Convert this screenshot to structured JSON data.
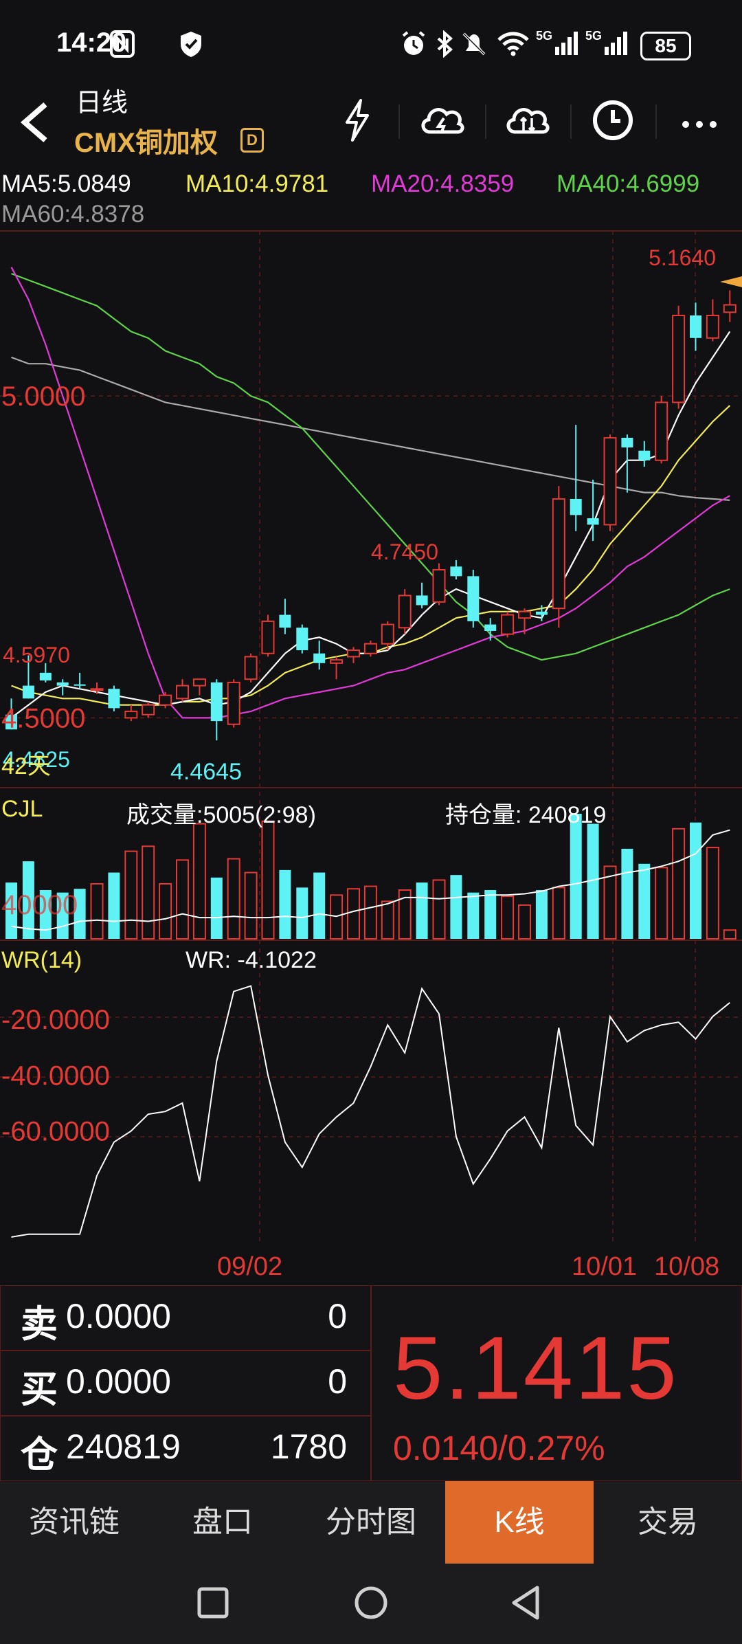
{
  "status": {
    "time": "14:20",
    "battery": "85"
  },
  "header": {
    "period": "日线",
    "symbol": "CMX铜加权",
    "badge": "D"
  },
  "ma": {
    "ma5": "MA5:5.0849",
    "ma10": "MA10:4.9781",
    "ma20": "MA20:4.8359",
    "ma40": "MA40:4.6999",
    "ma60": "MA60:4.8378"
  },
  "price_chart": {
    "axis_label_top": "5.0000",
    "axis_label_mid": "4.5000",
    "high_label": "5.1640",
    "peak_label": "4.7450",
    "left_label": "4.5970",
    "low_label": "4.4645",
    "left_low_label": "4.4825",
    "days_label": "42天"
  },
  "volume_panel": {
    "title": "CJL",
    "volume_text": "成交量:5005(2:98)",
    "oi_text": "持仓量: 240819",
    "axis_label": "40000"
  },
  "wr_panel": {
    "title": "WR(14)",
    "value_text": "WR: -4.1022",
    "ticks": [
      "-20.0000",
      "-40.0000",
      "-60.0000"
    ]
  },
  "dates": [
    "09/02",
    "10/01",
    "10/08"
  ],
  "order_book": {
    "sell_label": "卖",
    "sell_price": "0.0000",
    "sell_qty": "0",
    "buy_label": "买",
    "buy_price": "0.0000",
    "buy_qty": "0",
    "oi_label": "仓",
    "oi_value": "240819",
    "oi_change": "1780",
    "last_price": "5.1415",
    "change": "0.0140/0.27%"
  },
  "tabs": [
    "资讯链",
    "盘口",
    "分时图",
    "K线",
    "交易"
  ],
  "colors": {
    "up": "#e53935",
    "down": "#5ff2f5",
    "ma5": "#ffffff",
    "ma10": "#f2ec58",
    "ma20": "#e23ad8",
    "ma40": "#5fd44a",
    "ma60": "#aaaaaa",
    "accent": "#e06a2a"
  },
  "chart_data": {
    "type": "candlestick",
    "y_range": [
      4.43,
      5.22
    ],
    "candles": [
      {
        "o": 4.505,
        "h": 4.53,
        "l": 4.482,
        "c": 4.482
      },
      {
        "o": 4.55,
        "h": 4.597,
        "l": 4.53,
        "c": 4.53
      },
      {
        "o": 4.57,
        "h": 4.585,
        "l": 4.555,
        "c": 4.558
      },
      {
        "o": 4.555,
        "h": 4.56,
        "l": 4.535,
        "c": 4.55
      },
      {
        "o": 4.552,
        "h": 4.57,
        "l": 4.545,
        "c": 4.55
      },
      {
        "o": 4.545,
        "h": 4.555,
        "l": 4.537,
        "c": 4.545
      },
      {
        "o": 4.545,
        "h": 4.55,
        "l": 4.51,
        "c": 4.515
      },
      {
        "o": 4.5,
        "h": 4.52,
        "l": 4.495,
        "c": 4.51
      },
      {
        "o": 4.505,
        "h": 4.525,
        "l": 4.5,
        "c": 4.52
      },
      {
        "o": 4.52,
        "h": 4.54,
        "l": 4.515,
        "c": 4.535
      },
      {
        "o": 4.53,
        "h": 4.56,
        "l": 4.525,
        "c": 4.55
      },
      {
        "o": 4.55,
        "h": 4.56,
        "l": 4.535,
        "c": 4.56
      },
      {
        "o": 4.555,
        "h": 4.56,
        "l": 4.465,
        "c": 4.495
      },
      {
        "o": 4.49,
        "h": 4.56,
        "l": 4.485,
        "c": 4.555
      },
      {
        "o": 4.56,
        "h": 4.6,
        "l": 4.555,
        "c": 4.595
      },
      {
        "o": 4.6,
        "h": 4.66,
        "l": 4.595,
        "c": 4.65
      },
      {
        "o": 4.66,
        "h": 4.685,
        "l": 4.63,
        "c": 4.64
      },
      {
        "o": 4.64,
        "h": 4.645,
        "l": 4.6,
        "c": 4.605
      },
      {
        "o": 4.6,
        "h": 4.62,
        "l": 4.575,
        "c": 4.585
      },
      {
        "o": 4.585,
        "h": 4.595,
        "l": 4.56,
        "c": 4.59
      },
      {
        "o": 4.595,
        "h": 4.61,
        "l": 4.585,
        "c": 4.605
      },
      {
        "o": 4.6,
        "h": 4.62,
        "l": 4.595,
        "c": 4.615
      },
      {
        "o": 4.615,
        "h": 4.65,
        "l": 4.605,
        "c": 4.645
      },
      {
        "o": 4.64,
        "h": 4.7,
        "l": 4.63,
        "c": 4.69
      },
      {
        "o": 4.69,
        "h": 4.71,
        "l": 4.67,
        "c": 4.675
      },
      {
        "o": 4.68,
        "h": 4.74,
        "l": 4.675,
        "c": 4.73
      },
      {
        "o": 4.735,
        "h": 4.745,
        "l": 4.715,
        "c": 4.72
      },
      {
        "o": 4.72,
        "h": 4.73,
        "l": 4.64,
        "c": 4.65
      },
      {
        "o": 4.645,
        "h": 4.655,
        "l": 4.62,
        "c": 4.635
      },
      {
        "o": 4.63,
        "h": 4.665,
        "l": 4.625,
        "c": 4.66
      },
      {
        "o": 4.655,
        "h": 4.67,
        "l": 4.63,
        "c": 4.665
      },
      {
        "o": 4.665,
        "h": 4.675,
        "l": 4.65,
        "c": 4.66
      },
      {
        "o": 4.67,
        "h": 4.86,
        "l": 4.64,
        "c": 4.84
      },
      {
        "o": 4.84,
        "h": 4.955,
        "l": 4.79,
        "c": 4.815
      },
      {
        "o": 4.81,
        "h": 4.87,
        "l": 4.775,
        "c": 4.8
      },
      {
        "o": 4.8,
        "h": 4.94,
        "l": 4.79,
        "c": 4.935
      },
      {
        "o": 4.935,
        "h": 4.94,
        "l": 4.85,
        "c": 4.92
      },
      {
        "o": 4.915,
        "h": 4.93,
        "l": 4.89,
        "c": 4.9
      },
      {
        "o": 4.9,
        "h": 5.0,
        "l": 4.895,
        "c": 4.99
      },
      {
        "o": 4.99,
        "h": 5.14,
        "l": 4.98,
        "c": 5.125
      },
      {
        "o": 5.125,
        "h": 5.145,
        "l": 5.07,
        "c": 5.09
      },
      {
        "o": 5.09,
        "h": 5.15,
        "l": 5.085,
        "c": 5.125
      },
      {
        "o": 5.13,
        "h": 5.164,
        "l": 5.115,
        "c": 5.1415
      }
    ],
    "ma5": [
      4.5,
      4.52,
      4.54,
      4.55,
      4.545,
      4.54,
      4.535,
      4.53,
      4.525,
      4.52,
      4.525,
      4.53,
      4.52,
      4.525,
      4.54,
      4.57,
      4.6,
      4.62,
      4.625,
      4.615,
      4.6,
      4.6,
      4.605,
      4.63,
      4.66,
      4.685,
      4.7,
      4.69,
      4.68,
      4.67,
      4.66,
      4.655,
      4.7,
      4.75,
      4.8,
      4.87,
      4.9,
      4.9,
      4.91,
      4.97,
      5.02,
      5.06,
      5.1
    ],
    "ma10": [
      4.55,
      4.54,
      4.535,
      4.53,
      4.53,
      4.525,
      4.52,
      4.52,
      4.52,
      4.52,
      4.525,
      4.525,
      4.53,
      4.53,
      4.535,
      4.55,
      4.57,
      4.58,
      4.59,
      4.595,
      4.6,
      4.6,
      4.61,
      4.615,
      4.625,
      4.64,
      4.655,
      4.66,
      4.665,
      4.665,
      4.665,
      4.67,
      4.675,
      4.7,
      4.73,
      4.77,
      4.8,
      4.83,
      4.86,
      4.9,
      4.93,
      4.96,
      4.985
    ],
    "ma20": [
      5.2,
      5.15,
      5.08,
      5.0,
      4.92,
      4.84,
      4.76,
      4.68,
      4.6,
      4.53,
      4.5,
      4.5,
      4.5,
      4.505,
      4.51,
      4.52,
      4.53,
      4.535,
      4.54,
      4.545,
      4.55,
      4.56,
      4.57,
      4.575,
      4.585,
      4.595,
      4.605,
      4.615,
      4.625,
      4.63,
      4.635,
      4.645,
      4.655,
      4.67,
      4.69,
      4.71,
      4.735,
      4.75,
      4.77,
      4.79,
      4.81,
      4.83,
      4.845
    ],
    "ma40": [
      5.19,
      5.18,
      5.17,
      5.16,
      5.15,
      5.14,
      5.12,
      5.1,
      5.09,
      5.07,
      5.06,
      5.05,
      5.03,
      5.02,
      5.0,
      4.99,
      4.97,
      4.95,
      4.92,
      4.89,
      4.86,
      4.83,
      4.8,
      4.77,
      4.74,
      4.71,
      4.68,
      4.66,
      4.63,
      4.61,
      4.6,
      4.59,
      4.595,
      4.6,
      4.61,
      4.62,
      4.63,
      4.64,
      4.65,
      4.66,
      4.675,
      4.69,
      4.7
    ],
    "ma60": [
      5.06,
      5.05,
      5.05,
      5.045,
      5.04,
      5.03,
      5.02,
      5.01,
      5.0,
      4.99,
      4.985,
      4.98,
      4.975,
      4.97,
      4.965,
      4.96,
      4.955,
      4.95,
      4.945,
      4.94,
      4.935,
      4.93,
      4.925,
      4.92,
      4.915,
      4.91,
      4.905,
      4.9,
      4.895,
      4.89,
      4.885,
      4.88,
      4.875,
      4.87,
      4.865,
      4.86,
      4.855,
      4.85,
      4.85,
      4.845,
      4.842,
      4.84,
      4.838
    ],
    "volume": [
      0.45,
      0.62,
      0.39,
      0.37,
      0.4,
      0.44,
      0.53,
      0.7,
      0.74,
      0.44,
      0.63,
      0.92,
      0.49,
      0.64,
      0.53,
      0.94,
      0.55,
      0.41,
      0.53,
      0.35,
      0.4,
      0.42,
      0.3,
      0.39,
      0.45,
      0.47,
      0.51,
      0.37,
      0.39,
      0.34,
      0.27,
      0.39,
      0.41,
      1.0,
      0.92,
      0.58,
      0.72,
      0.6,
      0.57,
      0.88,
      0.93,
      0.73,
      0.07
    ],
    "oi_line": [
      0.1,
      0.08,
      0.07,
      0.1,
      0.14,
      0.15,
      0.14,
      0.15,
      0.14,
      0.16,
      0.2,
      0.17,
      0.17,
      0.18,
      0.17,
      0.17,
      0.18,
      0.17,
      0.2,
      0.18,
      0.22,
      0.25,
      0.28,
      0.33,
      0.33,
      0.32,
      0.33,
      0.34,
      0.35,
      0.35,
      0.36,
      0.38,
      0.42,
      0.44,
      0.47,
      0.5,
      0.53,
      0.55,
      0.58,
      0.62,
      0.68,
      0.83,
      0.87
    ],
    "wr": [
      -98,
      -97,
      -97,
      -97,
      -97,
      -76,
      -64,
      -60,
      -54,
      -53,
      -50,
      -78,
      -35,
      -10,
      -8,
      -40,
      -64,
      -73,
      -61,
      -55,
      -50,
      -37,
      -22,
      -32,
      -9,
      -18,
      -62,
      -79,
      -70,
      -60,
      -55,
      -66,
      -23,
      -58,
      -65,
      -19,
      -28,
      -24,
      -22,
      -21,
      -27,
      -19,
      -14
    ]
  }
}
